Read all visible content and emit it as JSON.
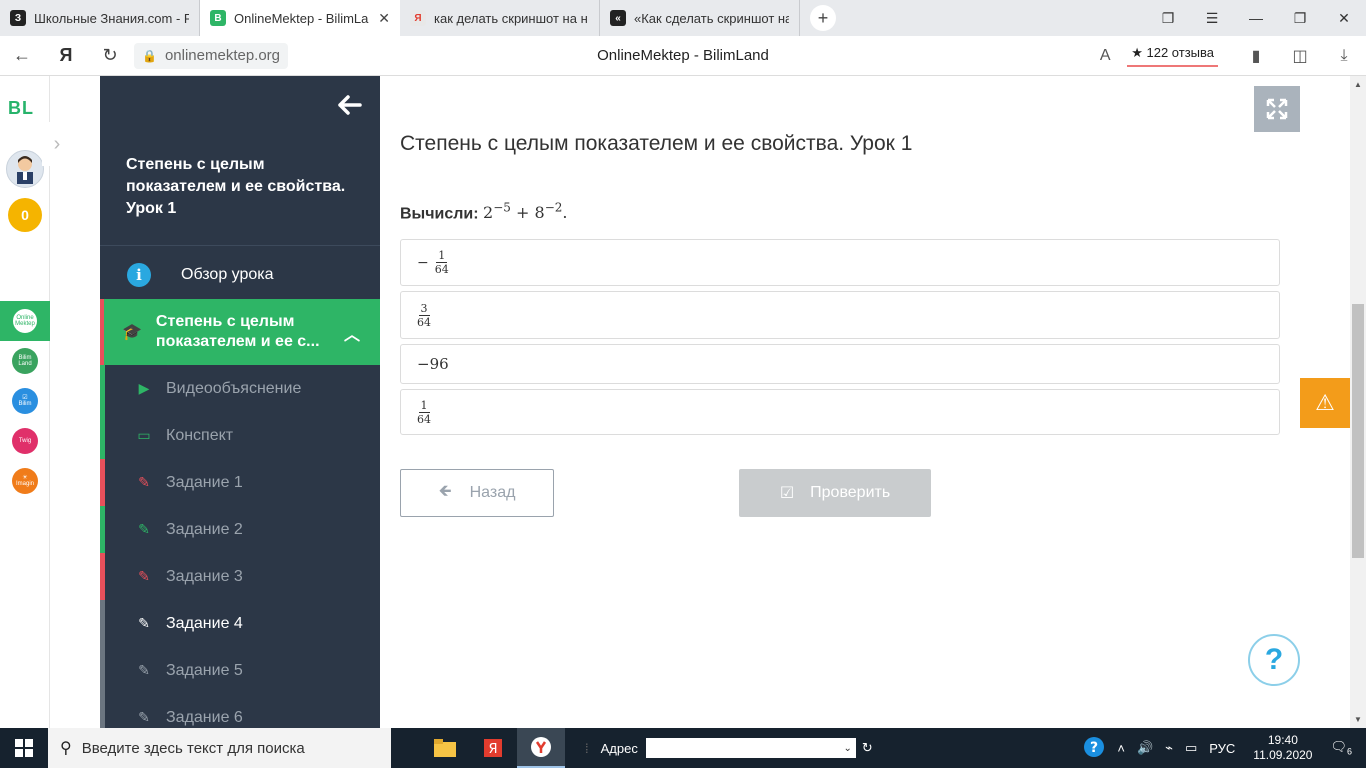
{
  "browser": {
    "tabs": [
      {
        "favicon": "З",
        "favicon_color": "#222222",
        "title": "Школьные Знания.com - Р",
        "active": false
      },
      {
        "favicon": "B",
        "favicon_color": "#2eb566",
        "title": "OnlineMektep - BilimLa",
        "active": true
      },
      {
        "favicon": "Я",
        "favicon_color": "#e8e8e8",
        "title": "как делать скриншот на н",
        "active": false
      },
      {
        "favicon": "«",
        "favicon_color": "#222222",
        "title": "«Как сделать скриншот на",
        "active": false
      }
    ],
    "url": "onlinemektep.org",
    "page_title": "OnlineMektep - BilimLand",
    "reviews": "★ 122 отзыва"
  },
  "rail": {
    "logo": "BL",
    "coins": "0",
    "apps": [
      {
        "name": "Online Mektep",
        "color": "#2eb566"
      },
      {
        "name": "Bilim Land",
        "color": "#3aa35f"
      },
      {
        "name": "Bilim",
        "color": "#2a8fe0"
      },
      {
        "name": "Twig",
        "color": "#e0306a"
      },
      {
        "name": "Imagin",
        "color": "#f07c1a"
      }
    ]
  },
  "sidebar": {
    "course_title": "Степень с целым показателем и ее свойства. Урок 1",
    "overview": "Обзор урока",
    "section_title": "Степень с целым показателем и ее с...",
    "items": [
      {
        "label": "Видеообъяснение",
        "icon": "▶",
        "icon_color": "#2eb566",
        "bar": "#2eb566"
      },
      {
        "label": "Конспект",
        "icon": "▭",
        "icon_color": "#2eb566",
        "bar": "#2eb566"
      },
      {
        "label": "Задание 1",
        "icon": "✎",
        "icon_color": "#e8505b",
        "bar": "#e8505b"
      },
      {
        "label": "Задание 2",
        "icon": "✎",
        "icon_color": "#2eb566",
        "bar": "#2eb566"
      },
      {
        "label": "Задание 3",
        "icon": "✎",
        "icon_color": "#e8505b",
        "bar": "#e8505b"
      },
      {
        "label": "Задание 4",
        "icon": "✎",
        "icon_color": "#ffffff",
        "bar": "#6b7580"
      },
      {
        "label": "Задание 5",
        "icon": "✎",
        "icon_color": "#9aa3ad",
        "bar": "#6b7580"
      },
      {
        "label": "Задание 6",
        "icon": "✎",
        "icon_color": "#9aa3ad",
        "bar": "#6b7580"
      }
    ]
  },
  "main": {
    "lesson_title": "Степень с целым показателем и ее свойства. Урок 1",
    "question_label": "Вычисли:",
    "question_base1": "2",
    "question_exp1": "−5",
    "question_plus": "+",
    "question_base2": "8",
    "question_exp2": "−2",
    "question_end": ".",
    "options": [
      {
        "sign": "−",
        "numerator": "1",
        "denominator": "64"
      },
      {
        "sign": "",
        "numerator": "3",
        "denominator": "64"
      },
      {
        "text": "−96"
      },
      {
        "sign": "",
        "numerator": "1",
        "denominator": "64"
      }
    ],
    "back_label": "Назад",
    "check_label": "Проверить"
  },
  "taskbar": {
    "search_placeholder": "Введите здесь текст для поиска",
    "address_label": "Адрес",
    "lang": "РУС",
    "time": "19:40",
    "date": "11.09.2020",
    "notifications": "6"
  }
}
